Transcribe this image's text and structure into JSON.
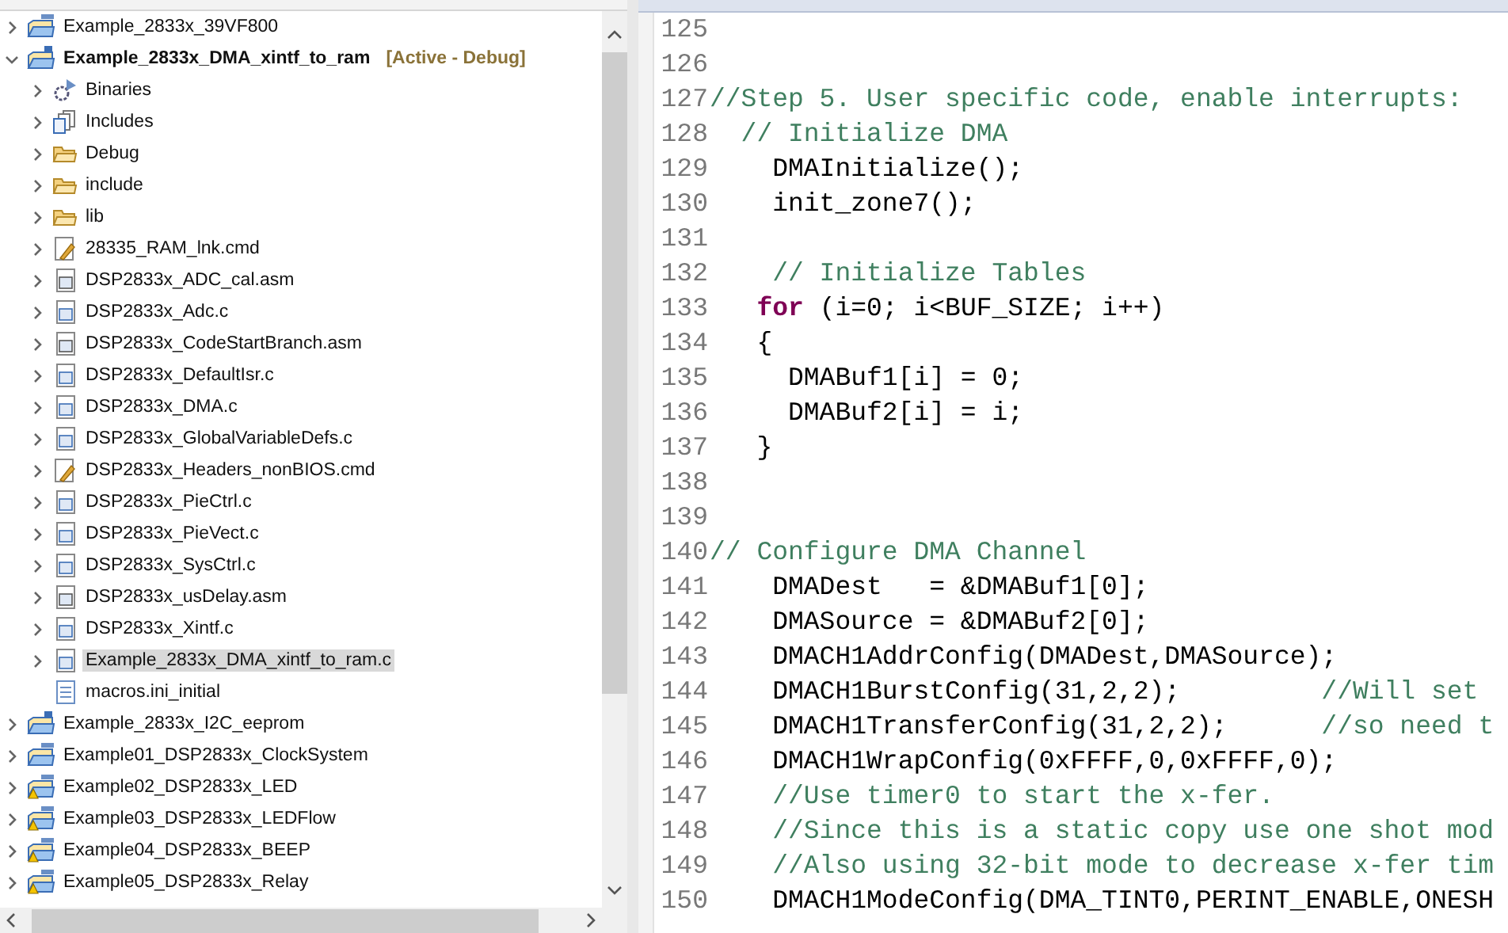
{
  "project_explorer": {
    "items": [
      {
        "label": "Example_2833x_39VF800",
        "kind": "ccs-project",
        "expanded": false,
        "selected": false
      },
      {
        "label": "Example_2833x_DMA_xintf_to_ram",
        "kind": "c-project",
        "expanded": true,
        "selected": false,
        "active_config": "[Active - Debug]",
        "children": [
          {
            "label": "Binaries",
            "kind": "binaries",
            "expandable": true,
            "selected": false
          },
          {
            "label": "Includes",
            "kind": "includes",
            "expandable": true,
            "selected": false
          },
          {
            "label": "Debug",
            "kind": "folder",
            "expandable": true,
            "selected": false
          },
          {
            "label": "include",
            "kind": "folder",
            "expandable": true,
            "selected": false
          },
          {
            "label": "lib",
            "kind": "folder",
            "expandable": true,
            "selected": false
          },
          {
            "label": "28335_RAM_lnk.cmd",
            "kind": "cmd",
            "expandable": true,
            "selected": false
          },
          {
            "label": "DSP2833x_ADC_cal.asm",
            "kind": "asm",
            "expandable": true,
            "selected": false
          },
          {
            "label": "DSP2833x_Adc.c",
            "kind": "c",
            "expandable": true,
            "selected": false
          },
          {
            "label": "DSP2833x_CodeStartBranch.asm",
            "kind": "asm",
            "expandable": true,
            "selected": false
          },
          {
            "label": "DSP2833x_DefaultIsr.c",
            "kind": "c",
            "expandable": true,
            "selected": false
          },
          {
            "label": "DSP2833x_DMA.c",
            "kind": "c",
            "expandable": true,
            "selected": false
          },
          {
            "label": "DSP2833x_GlobalVariableDefs.c",
            "kind": "c",
            "expandable": true,
            "selected": false
          },
          {
            "label": "DSP2833x_Headers_nonBIOS.cmd",
            "kind": "cmd",
            "expandable": true,
            "selected": false
          },
          {
            "label": "DSP2833x_PieCtrl.c",
            "kind": "c",
            "expandable": true,
            "selected": false
          },
          {
            "label": "DSP2833x_PieVect.c",
            "kind": "c",
            "expandable": true,
            "selected": false
          },
          {
            "label": "DSP2833x_SysCtrl.c",
            "kind": "c",
            "expandable": true,
            "selected": false
          },
          {
            "label": "DSP2833x_usDelay.asm",
            "kind": "asm",
            "expandable": true,
            "selected": false
          },
          {
            "label": "DSP2833x_Xintf.c",
            "kind": "c",
            "expandable": true,
            "selected": false
          },
          {
            "label": "Example_2833x_DMA_xintf_to_ram.c",
            "kind": "c",
            "expandable": true,
            "selected": true
          },
          {
            "label": "macros.ini_initial",
            "kind": "text",
            "expandable": false,
            "selected": false
          }
        ]
      },
      {
        "label": "Example_2833x_I2C_eeprom",
        "kind": "c-project",
        "expanded": false,
        "selected": false
      },
      {
        "label": "Example01_DSP2833x_ClockSystem",
        "kind": "ccs-project",
        "expanded": false,
        "selected": false
      },
      {
        "label": "Example02_DSP2833x_LED",
        "kind": "ccs-project",
        "expanded": false,
        "selected": false,
        "warning": true
      },
      {
        "label": "Example03_DSP2833x_LEDFlow",
        "kind": "ccs-project",
        "expanded": false,
        "selected": false,
        "warning": true
      },
      {
        "label": "Example04_DSP2833x_BEEP",
        "kind": "ccs-project",
        "expanded": false,
        "selected": false,
        "warning": true
      },
      {
        "label": "Example05_DSP2833x_Relay",
        "kind": "ccs-project",
        "expanded": false,
        "selected": false,
        "warning": true
      }
    ]
  },
  "editor": {
    "lines": [
      {
        "number": "125"
      },
      {
        "number": "126"
      },
      {
        "number": "127",
        "segments": [
          {
            "kind": "comment",
            "text": "//Step 5. User specific code, enable interrupts:"
          }
        ]
      },
      {
        "number": "128",
        "segments": [
          {
            "kind": "comment",
            "text": "  // Initialize DMA"
          }
        ]
      },
      {
        "number": "129",
        "segments": [
          {
            "kind": "code",
            "text": "    DMAInitialize();"
          }
        ]
      },
      {
        "number": "130",
        "segments": [
          {
            "kind": "code",
            "text": "    init_zone7();"
          }
        ]
      },
      {
        "number": "131"
      },
      {
        "number": "132",
        "segments": [
          {
            "kind": "comment",
            "text": "    // Initialize Tables"
          }
        ]
      },
      {
        "number": "133",
        "segments": [
          {
            "kind": "keyword",
            "text": "   for"
          },
          {
            "kind": "code",
            "text": " (i=0; i<BUF_SIZE; i++)"
          }
        ]
      },
      {
        "number": "134",
        "segments": [
          {
            "kind": "code",
            "text": "   {"
          }
        ]
      },
      {
        "number": "135",
        "segments": [
          {
            "kind": "code",
            "text": "     DMABuf1[i] = 0;"
          }
        ]
      },
      {
        "number": "136",
        "segments": [
          {
            "kind": "code",
            "text": "     DMABuf2[i] = i;"
          }
        ]
      },
      {
        "number": "137",
        "segments": [
          {
            "kind": "code",
            "text": "   }"
          }
        ]
      },
      {
        "number": "138"
      },
      {
        "number": "139"
      },
      {
        "number": "140",
        "segments": [
          {
            "kind": "comment",
            "text": "// Configure DMA Channel"
          }
        ]
      },
      {
        "number": "141",
        "segments": [
          {
            "kind": "code",
            "text": "    DMADest   = &DMABuf1[0];"
          }
        ]
      },
      {
        "number": "142",
        "segments": [
          {
            "kind": "code",
            "text": "    DMASource = &DMABuf2[0];"
          }
        ]
      },
      {
        "number": "143",
        "segments": [
          {
            "kind": "code",
            "text": "    DMACH1AddrConfig(DMADest,DMASource);"
          }
        ]
      },
      {
        "number": "144",
        "segments": [
          {
            "kind": "code",
            "text": "    DMACH1BurstConfig(31,2,2);         "
          },
          {
            "kind": "comment",
            "text": "//Will set"
          }
        ]
      },
      {
        "number": "145",
        "segments": [
          {
            "kind": "code",
            "text": "    DMACH1TransferConfig(31,2,2);      "
          },
          {
            "kind": "comment",
            "text": "//so need t"
          }
        ]
      },
      {
        "number": "146",
        "segments": [
          {
            "kind": "code",
            "text": "    DMACH1WrapConfig(0xFFFF,0,0xFFFF,0);"
          }
        ]
      },
      {
        "number": "147",
        "segments": [
          {
            "kind": "comment",
            "text": "    //Use timer0 to start the x-fer."
          }
        ]
      },
      {
        "number": "148",
        "segments": [
          {
            "kind": "comment",
            "text": "    //Since this is a static copy use one shot mod"
          }
        ]
      },
      {
        "number": "149",
        "segments": [
          {
            "kind": "comment",
            "text": "    //Also using 32-bit mode to decrease x-fer tim"
          }
        ]
      },
      {
        "number": "150",
        "segments": [
          {
            "kind": "code",
            "text": "    DMACH1ModeConfig(DMA_TINT0,PERINT_ENABLE,ONESH"
          }
        ]
      }
    ]
  }
}
